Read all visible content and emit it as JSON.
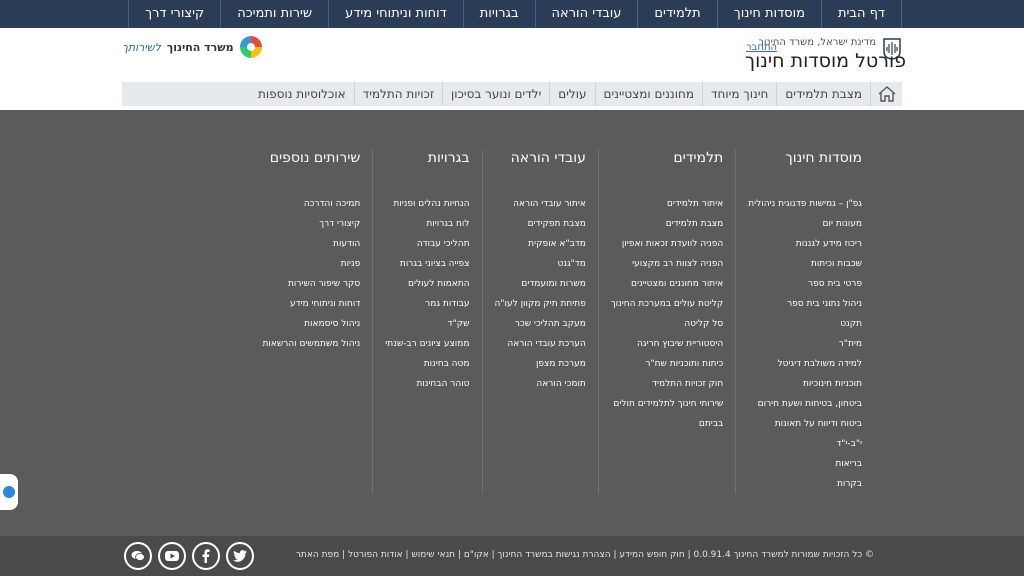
{
  "topnav": [
    "דף הבית",
    "מוסדות חינוך",
    "תלמידים",
    "עובדי הוראה",
    "בגרויות",
    "דוחות וניתוחי מידע",
    "שירות ותמיכה",
    "קיצורי דרך"
  ],
  "header": {
    "org_line": "מדינת ישראל, משרד החינוך",
    "portal_title": "פורטל מוסדות חינוך",
    "login": "התחבר",
    "ministry_name": "משרד החינוך",
    "ministry_script": "לשירותך"
  },
  "subnav": [
    "מצבת תלמידים",
    "חינוך מיוחד",
    "מחוננים ומצטיינים",
    "עולים",
    "ילדים ונוער בסיכון",
    "זכויות התלמיד",
    "אוכלוסיות נוספות"
  ],
  "columns": [
    {
      "title": "מוסדות חינוך",
      "links": [
        "גפ\"ן – גמישות פדגוגית ניהולית",
        "מעונות יום",
        "ריכוז מידע לגננות",
        "שכבות וכיתות",
        "פרטי בית ספר",
        "ניהול נתוני בית ספר",
        "תקנט",
        "מית\"ר",
        "למידה משולבת דיגיטל",
        "תוכניות חינוכיות",
        "ביטחון, בטיחות ושעת חירום",
        "ביטוח ודיווח על תאונות",
        "י\"ב-י\"ד",
        "בריאות",
        "בקרות"
      ]
    },
    {
      "title": "תלמידים",
      "links": [
        "איתור תלמידים",
        "מצבת תלמידים",
        "הפניה לוועדת זכאות ואפיון",
        "הפניה לצוות רב מקצועי",
        "איתור מחוננים ומצטיינים",
        "קליטת עולים במערכת החינוך",
        "סל קליטה",
        "היסטוריית שיבוץ חריגה",
        "כיתות ותוכניות שח\"ר",
        "חוק זכויות התלמיד",
        "שירותי חינוך לתלמידים חולים",
        "בביתם"
      ]
    },
    {
      "title": "עובדי הוראה",
      "links": [
        "איתור עובדי הוראה",
        "מצבת תפקידים",
        "מדב\"א אופקית",
        "מד\"גנט",
        "משרות ומועמדים",
        "פתיחת תיק מקוון לעו\"ה",
        "מעקב תהליכי שכר",
        "הערכת עובדי הוראה",
        "מערכת מצפן",
        "תומכי הוראה"
      ]
    },
    {
      "title": "בגרויות",
      "links": [
        "הנחיות נהלים ופניות",
        "לוח בגרויות",
        "תהליכי עבודה",
        "צפייה בציוני בגרות",
        "התאמות לעולים",
        "עבודות גמר",
        "שק\"ד",
        "ממוצע ציונים רב-שנתי",
        "מטה בחינות",
        "טוהר הבחינות"
      ]
    },
    {
      "title": "שירותים נוספים",
      "links": [
        "תמיכה והדרכה",
        "קיצורי דרך",
        "הודעות",
        "פניות",
        "סקר שיפור השירות",
        "דוחות וניתוחי מידע",
        "ניהול סיסמאות",
        "ניהול משתמשים והרשאות"
      ]
    }
  ],
  "footer": {
    "copyright": "כל הזכויות שמורות למשרד החינוך  0.0.91.4 | חוק חופש המידע | הצהרת נגישות במשרד החינוך | אקו\"ם | תנאי שימוש | אודות הפורטל | מפת האתר"
  },
  "icons": {
    "home": "home-icon",
    "social": [
      "twitter-icon",
      "facebook-icon",
      "youtube-icon",
      "chat-icon"
    ]
  },
  "colors": {
    "topnav": "#2a3c56",
    "background": "#5b5b5b",
    "footer": "#4a4a4a",
    "subnav": "#e6eaee"
  }
}
